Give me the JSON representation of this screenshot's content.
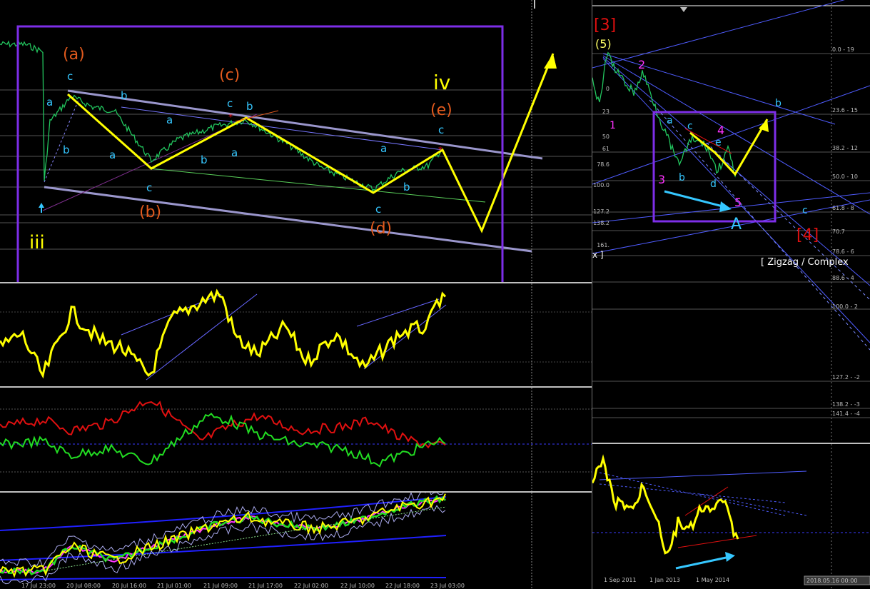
{
  "colors": {
    "price": "#22c55e",
    "yellow": "#ffff00",
    "purple": "#7d2ee8",
    "cyan": "#35c7ff",
    "orange": "#e25a1d",
    "magenta": "#ff33ff",
    "red": "#e01010",
    "green": "#22dd22",
    "grid": "#555555"
  },
  "left_chart": {
    "labels": {
      "a_major": "(a)",
      "b_major": "(b)",
      "c_major": "(c)",
      "d_major": "(d)",
      "e_major": "(e)",
      "iii": "iii",
      "iv": "iv",
      "c1": "c",
      "a1": "a",
      "b1": "b",
      "b2": "b",
      "a2": "a",
      "c2": "c",
      "a3": "a",
      "b3": "b",
      "c3": "c",
      "b4": "b",
      "a4": "a",
      "a5": "a",
      "b5": "b",
      "c5": "c",
      "c6": "c"
    },
    "x_tick_labels": [
      "17 Jul 23:00",
      "20 Jul 08:00",
      "20 Jul 16:00",
      "21 Jul 01:00",
      "21 Jul 09:00",
      "21 Jul 17:00",
      "22 Jul 02:00",
      "22 Jul 10:00",
      "22 Jul 18:00",
      "23 Jul 03:00"
    ]
  },
  "right_chart": {
    "labels": {
      "deg3": "[3]",
      "deg4": "[4]",
      "w5": "(5)",
      "n1": "1",
      "n2": "2",
      "n3": "3",
      "n4": "4",
      "n5": "5",
      "a": "a",
      "b": "b",
      "c": "c",
      "d": "d",
      "e": "e",
      "A": "A",
      "b_top": "b",
      "c_right": "c",
      "zigzag": "[ Zigzag / Complex",
      "x_mark": "x ]"
    },
    "fib_levels": [
      "0.0 - 19",
      "23.6 - 15",
      "38.2 - 12",
      "50.0 - 10",
      "61.8 - 8",
      "70.7",
      "78.6 - 6",
      "88.6 - 4",
      "100.0 - 2",
      "127.2 - -2",
      "138.2 - -3",
      "141.4 - -4"
    ],
    "side_levels": [
      "0",
      "23",
      "50",
      "61",
      "78.6",
      "100.0",
      "127.2",
      "138.2",
      "161."
    ],
    "x_tick_labels": [
      "1 Sep 2011",
      "1 Jan 2013",
      "1 May 2014"
    ],
    "date_box": "2018.05.16 00:00"
  },
  "chart_data": [
    {
      "type": "line",
      "title": "",
      "xlabel": "",
      "ylabel": "",
      "categories": [
        "17 Jul 23:00",
        "20 Jul 08:00",
        "20 Jul 16:00",
        "21 Jul 01:00",
        "21 Jul 09:00",
        "21 Jul 17:00",
        "22 Jul 02:00",
        "22 Jul 10:00",
        "22 Jul 18:00",
        "23 Jul 03:00"
      ],
      "series": [
        {
          "values": [
            0.92,
            0.78,
            0.55,
            0.62,
            0.72,
            0.56,
            0.44,
            0.38,
            0.5,
            0.6
          ]
        }
      ],
      "wave_path": {
        "points": [
          "(a)",
          "(b)",
          "(c)",
          "(d)",
          "(e)"
        ]
      },
      "ylim": [
        0,
        1
      ],
      "grid": true
    },
    {
      "type": "line",
      "title": "",
      "xlabel": "",
      "ylabel": "",
      "categories": [
        "1 Sep 2011",
        "1 Jan 2013",
        "1 May 2014"
      ],
      "series": [
        {
          "values": [
            0.95,
            0.45,
            0.35
          ]
        }
      ],
      "ylim": [
        0,
        1
      ],
      "grid": true
    }
  ]
}
